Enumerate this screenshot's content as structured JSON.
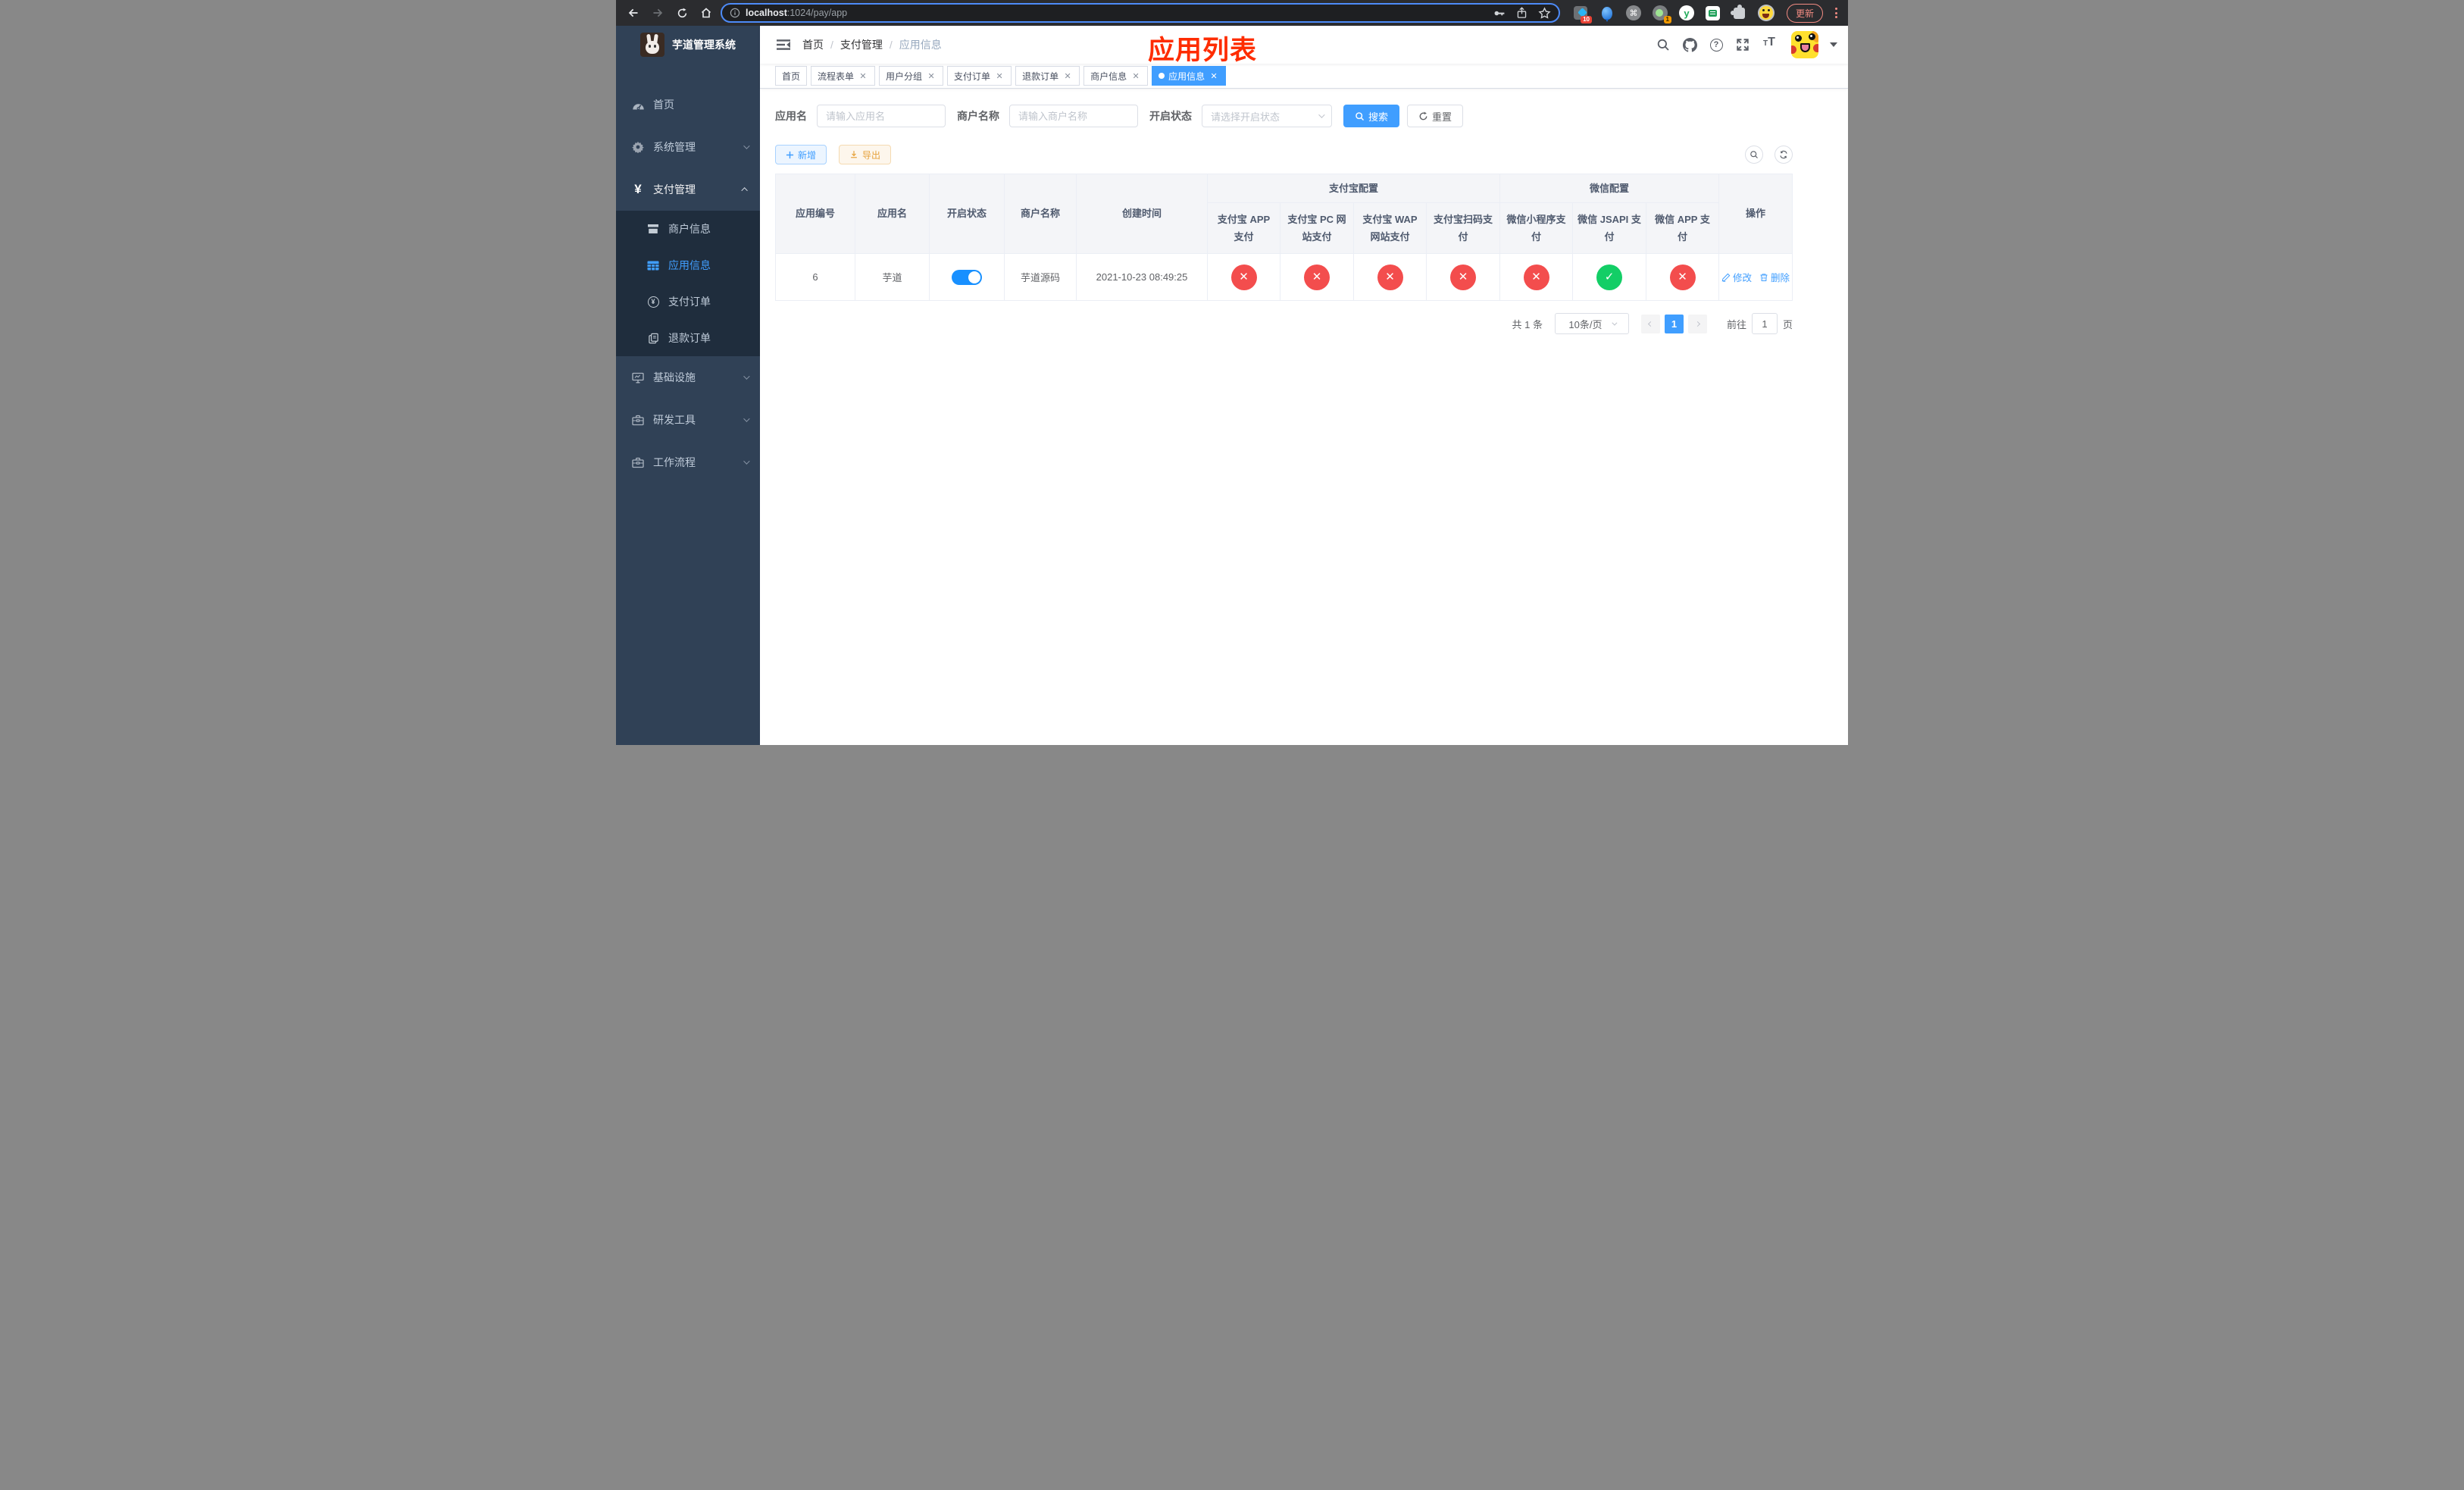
{
  "browser": {
    "url": {
      "host": "localhost",
      "path": ":1024/pay/app"
    },
    "update_label": "更新",
    "extension_badges": {
      "first": "10",
      "second": "1"
    }
  },
  "sidebar": {
    "title": "芋道管理系统",
    "items": [
      {
        "label": "首页"
      },
      {
        "label": "系统管理"
      },
      {
        "label": "支付管理"
      },
      {
        "label": "商户信息"
      },
      {
        "label": "应用信息"
      },
      {
        "label": "支付订单"
      },
      {
        "label": "退款订单"
      },
      {
        "label": "基础设施"
      },
      {
        "label": "研发工具"
      },
      {
        "label": "工作流程"
      }
    ]
  },
  "navbar": {
    "breadcrumb": [
      "首页",
      "支付管理",
      "应用信息"
    ],
    "overlay_title": "应用列表"
  },
  "tags": {
    "items": [
      {
        "label": "首页"
      },
      {
        "label": "流程表单"
      },
      {
        "label": "用户分组"
      },
      {
        "label": "支付订单"
      },
      {
        "label": "退款订单"
      },
      {
        "label": "商户信息"
      },
      {
        "label": "应用信息"
      }
    ]
  },
  "filters": {
    "app_name": {
      "label": "应用名",
      "placeholder": "请输入应用名",
      "value": ""
    },
    "merchant_name": {
      "label": "商户名称",
      "placeholder": "请输入商户名称",
      "value": ""
    },
    "status": {
      "label": "开启状态",
      "placeholder": "请选择开启状态"
    },
    "search_label": "搜索",
    "reset_label": "重置"
  },
  "toolbar": {
    "add_label": "新增",
    "export_label": "导出"
  },
  "table": {
    "headers": {
      "app_id": "应用编号",
      "app_name": "应用名",
      "status": "开启状态",
      "merchant": "商户名称",
      "created": "创建时间",
      "alipay_group": "支付宝配置",
      "wechat_group": "微信配置",
      "actions": "操作",
      "sub": [
        "支付宝 APP 支付",
        "支付宝 PC 网站支付",
        "支付宝 WAP 网站支付",
        "支付宝扫码支付",
        "微信小程序支付",
        "微信 JSAPI 支付",
        "微信 APP 支付"
      ]
    },
    "row": {
      "app_id": "6",
      "app_name": "芋道",
      "enabled": true,
      "merchant": "芋道源码",
      "created": "2021-10-23 08:49:25",
      "configs": [
        false,
        false,
        false,
        false,
        false,
        true,
        false
      ],
      "edit_label": "修改",
      "delete_label": "删除"
    }
  },
  "pagination": {
    "total": "共 1 条",
    "page_size": "10条/页",
    "page": "1",
    "goto_label": "前往",
    "goto_value": "1",
    "goto_suffix": "页"
  },
  "colors": {
    "accent": "#409eff",
    "success": "#13ce66",
    "danger": "#f34d4d",
    "warning": "#e6a23c",
    "sidebar_bg": "#304156",
    "submenu_bg": "#1f2d3d",
    "title_red": "#fe2c00",
    "toggle_on": "#1890ff"
  }
}
